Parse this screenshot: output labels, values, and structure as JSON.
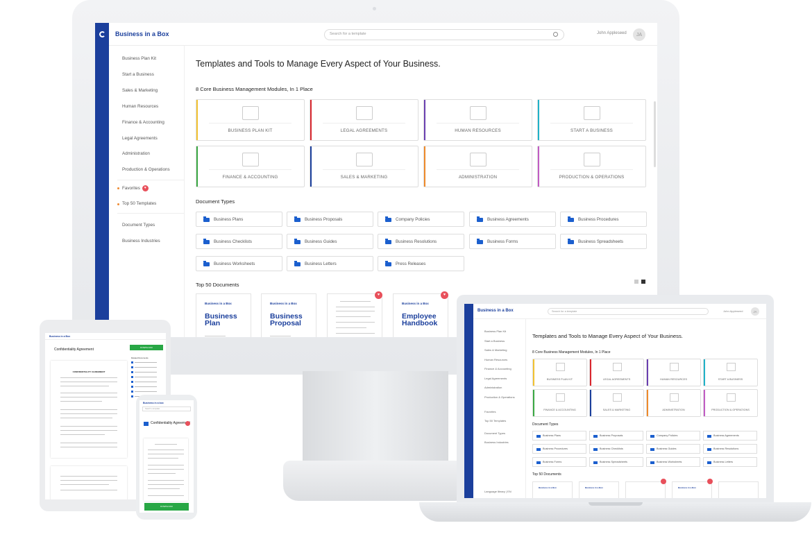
{
  "desktop": {
    "brand": "Business in a Box",
    "search_placeholder": "Search for a template",
    "user_name": "John Appleseed",
    "avatar_initials": "JA",
    "sidebar": {
      "items": [
        "Business Plan Kit",
        "Start a Business",
        "Sales & Marketing",
        "Human Resources",
        "Finance & Accounting",
        "Legal Agreements",
        "Administration",
        "Production & Operations"
      ],
      "favorites": "Favorites",
      "top50": "Top 50 Templates",
      "document_types": "Document Types",
      "business_industries": "Business Industries"
    },
    "page_title": "Templates and Tools to Manage Every Aspect of Your Business.",
    "modules_heading": "8 Core Business Management Modules, In 1 Place",
    "modules": [
      {
        "label": "BUSINESS PLAN KIT",
        "color": "#f2c230"
      },
      {
        "label": "LEGAL AGREEMENTS",
        "color": "#d9262e"
      },
      {
        "label": "HUMAN RESOURCES",
        "color": "#6a3fb0"
      },
      {
        "label": "START A BUSINESS",
        "color": "#1fb2c8"
      },
      {
        "label": "FINANCE & ACCOUNTING",
        "color": "#3aa843"
      },
      {
        "label": "SALES & MARKETING",
        "color": "#1b3f9c"
      },
      {
        "label": "ADMINISTRATION",
        "color": "#ef8a2a"
      },
      {
        "label": "PRODUCTION & OPERATIONS",
        "color": "#c15cc4"
      }
    ],
    "doc_types_heading": "Document Types",
    "doc_types": [
      "Business Plans",
      "Business Proposals",
      "Company Policies",
      "Business Agreements",
      "Business Procedures",
      "Business Checklists",
      "Business Guides",
      "Business Resolutions",
      "Business Forms",
      "Business Spreadsheets",
      "Business Worksheets",
      "Business Letters",
      "Press Releases"
    ],
    "top50_heading": "Top 50 Documents",
    "top_docs": [
      {
        "logo": "Business in a Box",
        "title": "Business Plan"
      },
      {
        "logo": "Business in a Box",
        "title": "Business Proposal"
      },
      {
        "logo": "",
        "title": ""
      },
      {
        "logo": "Business in a Box",
        "title": "Employee Handbook"
      }
    ]
  },
  "laptop": {
    "brand": "Business in a Box",
    "search_placeholder": "Search for a template",
    "user_name": "John Appleseed",
    "avatar_initials": "JA",
    "sidebar": {
      "items": [
        "Business Plan Kit",
        "Start a Business",
        "Sales & Marketing",
        "Human Resources",
        "Finance & Accounting",
        "Legal Agreements",
        "Administration",
        "Production & Operations"
      ],
      "favorites": "Favorites",
      "top50": "Top 50 Templates",
      "document_types": "Document Types",
      "business_industries": "Business Industries",
      "language": "Language library | EN"
    },
    "page_title": "Templates and Tools to Manage Every Aspect of Your Business.",
    "modules_heading": "8 Core Business Management Modules, In 1 Place",
    "modules": [
      "BUSINESS PLAN KIT",
      "LEGAL AGREEMENTS",
      "HUMAN RESOURCES",
      "START A BUSINESS",
      "FINANCE & ACCOUNTING",
      "SALES & MARKETING",
      "ADMINISTRATION",
      "PRODUCTION & OPERATIONS"
    ],
    "doc_types_heading": "Document Types",
    "doc_types": [
      "Business Plans",
      "Business Proposals",
      "Company Policies",
      "Business Agreements",
      "Business Procedures",
      "Business Checklists",
      "Business Guides",
      "Business Resolutions",
      "Business Forms",
      "Business Spreadsheets",
      "Business Worksheets",
      "Business Letters"
    ],
    "top50_heading": "Top 50 Documents"
  },
  "tablet": {
    "brand": "Business in a Box",
    "doc_title": "Confidentiality Agreement",
    "download": "DOWNLOAD",
    "related": "Related Documents",
    "doc_heading": "CONFIDENTIALITY AGREEMENT"
  },
  "phone": {
    "brand": "Business in a box",
    "search_placeholder": "Search a template",
    "doc_title": "Confidentiality Agreement",
    "download": "DOWNLOAD"
  }
}
